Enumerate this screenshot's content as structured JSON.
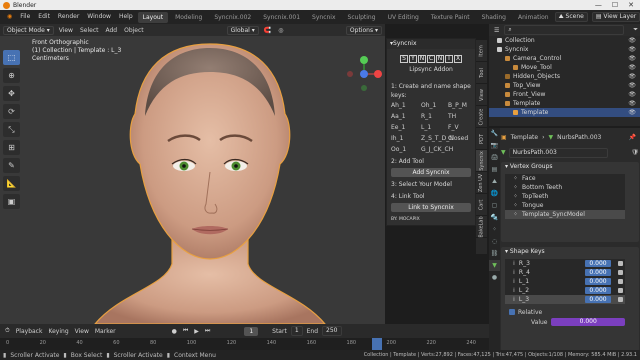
{
  "window": {
    "title": "Blender"
  },
  "menu": [
    "File",
    "Edit",
    "Render",
    "Window",
    "Help"
  ],
  "tabs": [
    "Layout",
    "Modeling",
    "Syncnix.002",
    "Syncnix.001",
    "Syncnix",
    "Sculpting",
    "UV Editing",
    "Texture Paint",
    "Shading",
    "Animation"
  ],
  "active_tab": "Layout",
  "scene": {
    "label": "Scene",
    "view_layer": "View Layer"
  },
  "viewport": {
    "mode": "Object Mode",
    "menus": [
      "View",
      "Select",
      "Add",
      "Object"
    ],
    "orientation": "Global",
    "options": "Options",
    "info_line1": "Front Orthographic",
    "info_line2": "(1) Collection | Template : L_3",
    "info_line3": "Centimeters"
  },
  "sidebar_tabs": [
    "Item",
    "Tool",
    "View",
    "Create",
    "PDT",
    "Syncnix",
    "Zen UV",
    "Cart",
    "BakeLab"
  ],
  "syncnix_panel": {
    "title": "Syncnix",
    "logo_letters": [
      "S",
      "Y",
      "N",
      "C",
      "N",
      "I",
      "X"
    ],
    "subtitle": "Lipsync Addon",
    "step1": "1: Create and name shape keys:",
    "keys": [
      "Ah_1",
      "Oh_1",
      "B_P_M",
      "Aa_1",
      "R_1",
      "TH",
      "Ee_1",
      "L_1",
      "F_V",
      "Ih_1",
      "Z_S_T_D_N",
      "Closed",
      "Oo_1",
      "G_J_CK_CH",
      ""
    ],
    "step2": "2: Add Tool",
    "add_btn": "Add Syncnix",
    "step3": "3: Select Your Model",
    "step4": "4: Link Tool",
    "link_btn": "Link to Syncnix",
    "footer": "BY: MOCAPIX"
  },
  "timeline": {
    "menus": [
      "Playback",
      "Keying",
      "View",
      "Marker"
    ],
    "current_frame": "1",
    "start_label": "Start",
    "start": "1",
    "end_label": "End",
    "end": "250",
    "ruler_ticks": [
      "0",
      "20",
      "40",
      "60",
      "80",
      "100",
      "120",
      "140",
      "160",
      "180",
      "200",
      "220",
      "240"
    ]
  },
  "outliner": {
    "items": [
      {
        "label": "Collection",
        "indent": 1,
        "color": "#cccccc",
        "sel": false
      },
      {
        "label": "Syncnix",
        "indent": 1,
        "color": "#cccccc",
        "sel": false
      },
      {
        "label": "Camera_Control",
        "indent": 2,
        "color": "#c88a3c",
        "sel": false
      },
      {
        "label": "Move_Tool",
        "indent": 3,
        "color": "#c88a3c",
        "sel": false
      },
      {
        "label": "Hidden_Objects",
        "indent": 2,
        "color": "#9a6a2a",
        "sel": false
      },
      {
        "label": "Top_View",
        "indent": 2,
        "color": "#c88a3c",
        "sel": false
      },
      {
        "label": "Front_View",
        "indent": 2,
        "color": "#c88a3c",
        "sel": false
      },
      {
        "label": "Template",
        "indent": 2,
        "color": "#c88a3c",
        "sel": false
      },
      {
        "label": "Template",
        "indent": 3,
        "color": "#e8a040",
        "sel": true
      }
    ]
  },
  "properties": {
    "object_name": "Template",
    "data_name": "NurbsPath.003",
    "mesh_name": "NurbsPath.003",
    "vertex_groups_title": "Vertex Groups",
    "vertex_groups": [
      "Face",
      "Bottom Teeth",
      "TopTeeth",
      "Tongue",
      "Template_SyncModel"
    ],
    "shape_keys_title": "Shape Keys",
    "shape_keys": [
      {
        "name": "R_3",
        "value": "0.000"
      },
      {
        "name": "R_4",
        "value": "0.000"
      },
      {
        "name": "L_1",
        "value": "0.000"
      },
      {
        "name": "L_2",
        "value": "0.000"
      },
      {
        "name": "L_3",
        "value": "0.000"
      }
    ],
    "relative_label": "Relative",
    "value_label": "Value",
    "value": "0.000"
  },
  "status": {
    "items": [
      "Scroller Activate",
      "Box Select",
      "Scroller Activate",
      "Context Menu"
    ],
    "right": "Collection | Template | Verts:27,892 | Faces:47,125 | Tris:47,475 | Objects:1/108 | Memory: 585.4 MiB | 2.93.1"
  },
  "colors": {
    "accent": "#4772b3",
    "selection_outline": "#e8a040"
  }
}
